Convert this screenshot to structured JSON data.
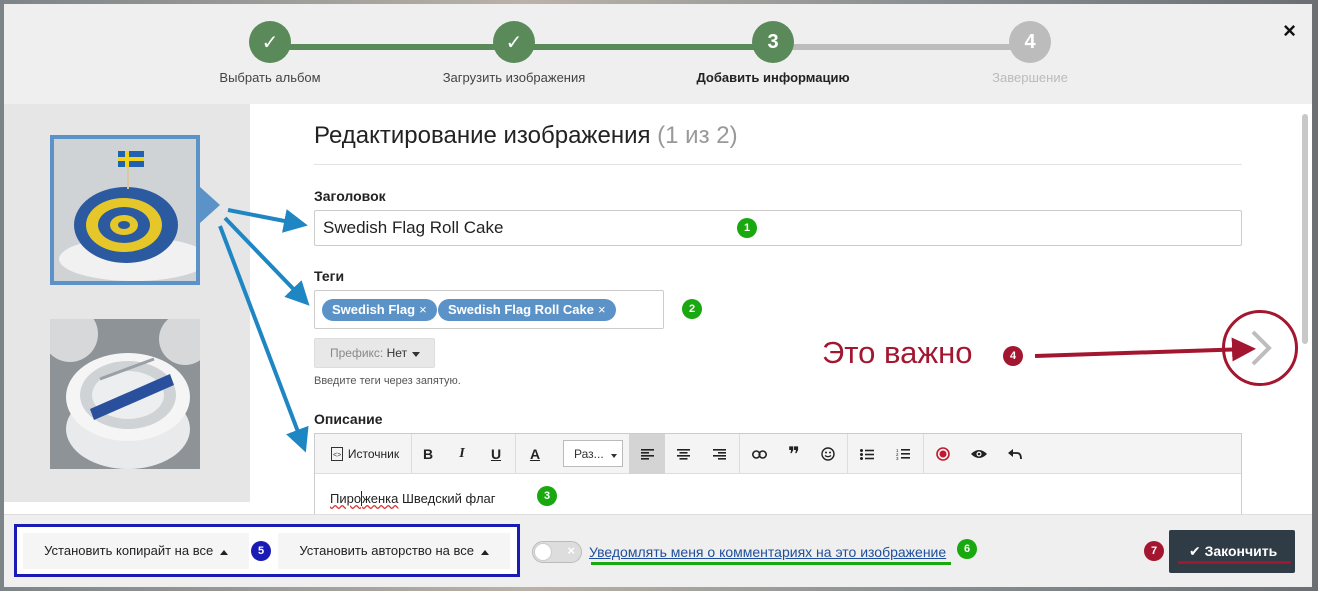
{
  "wizard": {
    "steps": [
      {
        "label": "Выбрать альбом",
        "mark": "✓",
        "state": "done"
      },
      {
        "label": "Загрузить изображения",
        "mark": "✓",
        "state": "done"
      },
      {
        "label": "Добавить информацию",
        "mark": "3",
        "state": "active"
      },
      {
        "label": "Завершение",
        "mark": "4",
        "state": "pending"
      }
    ],
    "close_icon": "×"
  },
  "editor": {
    "title": "Редактирование изображения",
    "count": "(1 из 2)",
    "title_field": {
      "label": "Заголовок",
      "value": "Swedish Flag Roll Cake"
    },
    "tags": {
      "label": "Теги",
      "items": [
        "Swedish Flag",
        "Swedish Flag Roll Cake"
      ],
      "remove_icon": "×",
      "prefix_label": "Префикс:",
      "prefix_value": "Нет",
      "hint": "Введите теги через запятую."
    },
    "description": {
      "label": "Описание",
      "source_label": "Источник",
      "bold": "B",
      "italic": "I",
      "underline": "U",
      "font_color": "A",
      "size_label": "Раз...",
      "quote": "❞",
      "text_a": "Пиро",
      "text_b": "женка",
      "text_c": " Шведский флаг"
    }
  },
  "annotations": {
    "badges": [
      "1",
      "2",
      "3",
      "4",
      "5",
      "6",
      "7"
    ],
    "important": "Это важно"
  },
  "footer": {
    "copyright_btn": "Установить копирайт на все",
    "author_btn": "Установить авторство на все",
    "toggle_off": "×",
    "notify": "Уведомлять меня о комментариях на это изображение",
    "finish": "Закончить",
    "finish_icon": "✔"
  },
  "colors": {
    "done": "#5a8a5a",
    "active": "#5a8a5a",
    "pending": "#bcbcbc",
    "accent_blue": "#5b93c8",
    "annotation_green": "#19a80f",
    "annotation_red": "#a3162f",
    "annotation_blue": "#1a1ab5"
  }
}
